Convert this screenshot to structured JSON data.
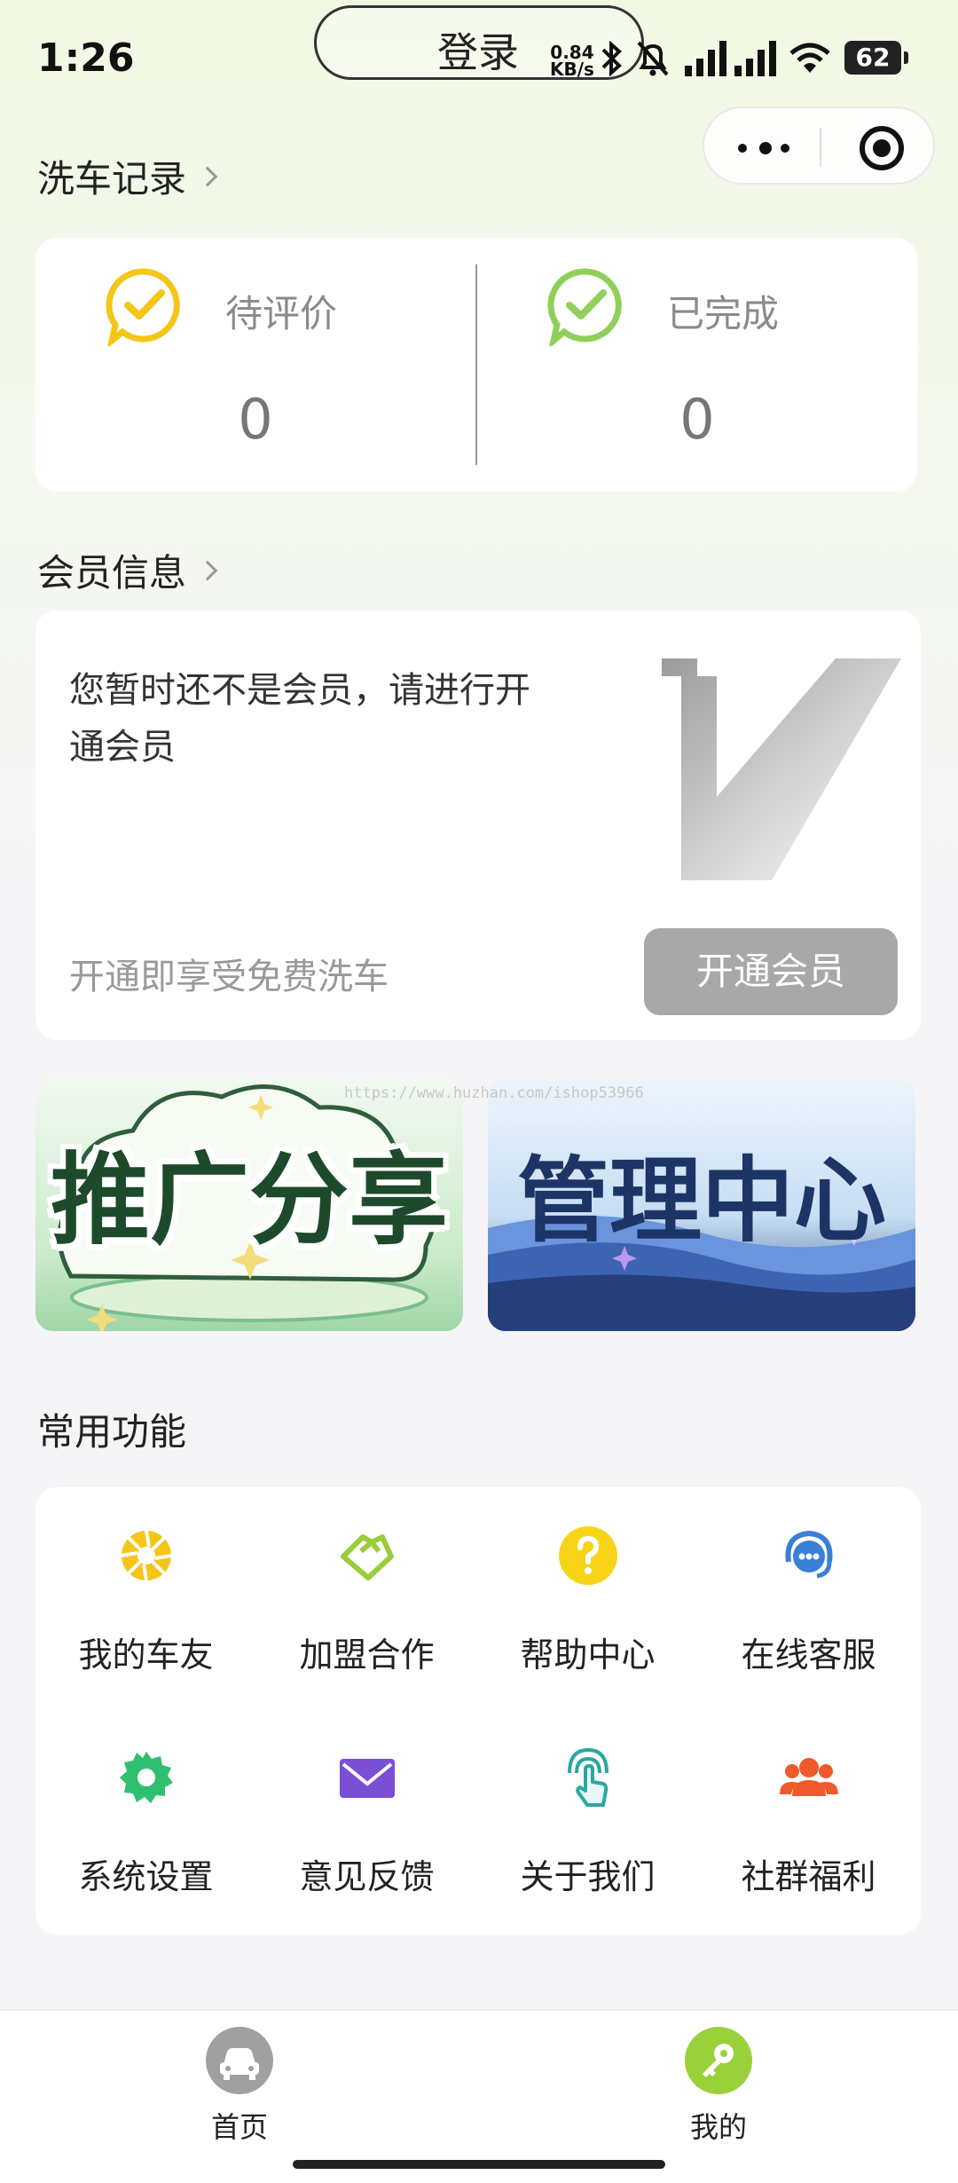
{
  "status_bar": {
    "time": "1:26",
    "login_label": "登录",
    "net_speed_value": "0.84",
    "net_speed_unit": "KB/s",
    "battery": "62"
  },
  "wash_records": {
    "title": "洗车记录",
    "pending_label": "待评价",
    "pending_count": "0",
    "done_label": "已完成",
    "done_count": "0"
  },
  "member": {
    "title": "会员信息",
    "notice": "您暂时还不是会员，请进行开通会员",
    "benefit": "开通即享受免费洗车",
    "button": "开通会员"
  },
  "banners": {
    "promo": "推广分享",
    "admin": "管理中心",
    "watermark": "https://www.huzhan.com/ishop53966"
  },
  "functions": {
    "title": "常用功能",
    "items": [
      {
        "label": "我的车友",
        "icon": "aperture-icon",
        "color": "#f5c518"
      },
      {
        "label": "加盟合作",
        "icon": "handshake-icon",
        "color": "#9ccc3c"
      },
      {
        "label": "帮助中心",
        "icon": "help-icon",
        "color": "#f7d417"
      },
      {
        "label": "在线客服",
        "icon": "headset-icon",
        "color": "#3a7fd5"
      },
      {
        "label": "系统设置",
        "icon": "gear-icon",
        "color": "#2fbf71"
      },
      {
        "label": "意见反馈",
        "icon": "mail-icon",
        "color": "#7a4fd6"
      },
      {
        "label": "关于我们",
        "icon": "touch-icon",
        "color": "#2aa8a0"
      },
      {
        "label": "社群福利",
        "icon": "group-icon",
        "color": "#f0592b"
      }
    ]
  },
  "tabbar": {
    "home": "首页",
    "mine": "我的",
    "active_color": "#9ad13b",
    "inactive_color": "#a0a0a0"
  }
}
